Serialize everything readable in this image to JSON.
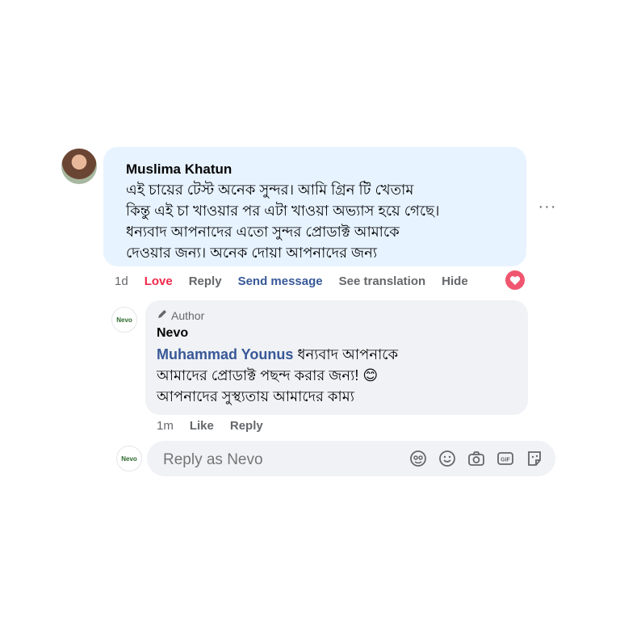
{
  "comment": {
    "author": "Muslima Khatun",
    "lines": [
      "এই চায়ের টেস্ট অনেক সুন্দর। আমি গ্রিন টি খেতাম",
      "কিন্তু এই চা খাওয়ার পর এটা খাওয়া অভ্যাস হয়ে গেছে।",
      "ধন্যবাদ আপনাদের এতো সুন্দর প্রোডাক্ট আমাকে",
      "দেওয়ার জন্য। অনেক দোয়া আপনাদের জন্য"
    ],
    "time": "1d",
    "love_label": "Love",
    "reply_label": "Reply",
    "send_message_label": "Send message",
    "see_translation_label": "See translation",
    "hide_label": "Hide",
    "more_label": "···"
  },
  "reply": {
    "avatar_text": "Nevo",
    "badge": "Author",
    "page_name": "Nevo",
    "mention": "Muhammad Younus",
    "line1_rest": " ধন্যবাদ আপনাকে",
    "line2": "আমাদের প্রোডাক্ট পছন্দ করার জন্য! 😊",
    "line3": "আপনাদের সুস্থ্যতায় আমাদের কাম্য",
    "time": "1m",
    "like_label": "Like",
    "reply_label": "Reply"
  },
  "composer": {
    "avatar_text": "Nevo",
    "placeholder": "Reply as Nevo"
  },
  "colors": {
    "love": "#f0284a",
    "link": "#385898",
    "mention": "#385898",
    "bubble_main": "#e7f3ff",
    "bubble_reply": "#f0f2f5"
  },
  "icons": [
    "avatar-sticker-icon",
    "emoji-icon",
    "camera-icon",
    "gif-icon",
    "sticker-icon",
    "heart-icon",
    "pencil-icon"
  ]
}
